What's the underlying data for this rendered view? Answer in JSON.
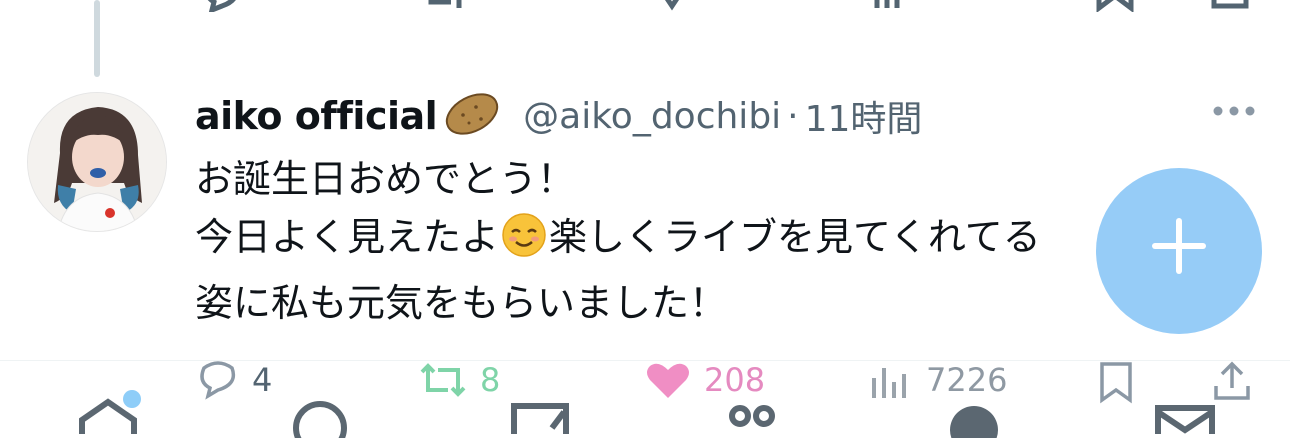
{
  "tweet": {
    "display_name": "aiko official",
    "name_emoji": "potato-emoji",
    "handle": "@aiko_dochibi",
    "separator": "·",
    "time": "11時間",
    "text_line1": "お誕生日おめでとう！",
    "text_line2_before_emoji": "今日よく見えたよ",
    "inline_emoji": "smiling-face-emoji",
    "text_line2_after_emoji": "楽しくライブを見てくれてる",
    "text_line3": "姿に私も元気をもらいました！",
    "stats": {
      "replies": "4",
      "retweets": "8",
      "likes": "208",
      "views": "7226"
    }
  },
  "colors": {
    "secondary_text": "#536471",
    "retweet": "#7fd4a8",
    "like": "#e58ac0",
    "fab": "#78bef5",
    "notification_dot": "#8ecdf8"
  },
  "bottom_nav": {
    "items": [
      "home-icon",
      "search-icon",
      "compose-icon",
      "communities-icon",
      "profile-icon",
      "messages-icon"
    ]
  }
}
